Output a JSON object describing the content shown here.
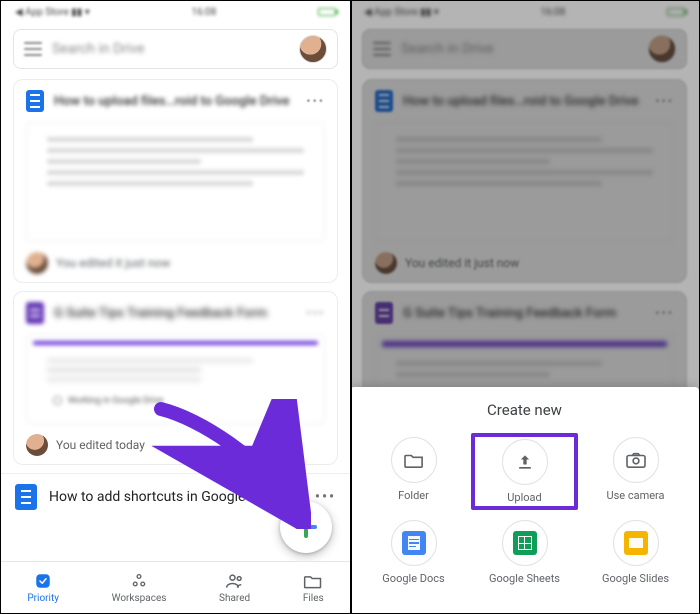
{
  "left": {
    "search_placeholder": "Search in Drive",
    "card1": {
      "title": "How to upload files…roid to Google Drive",
      "footer": "You edited it just now"
    },
    "card2": {
      "title": "G Suite Tips Training Feedback Form",
      "working": "Working in Google Drive",
      "footer": "You edited today"
    },
    "row_title": "How to add shortcuts in Google Drive",
    "nav": {
      "priority": "Priority",
      "workspaces": "Workspaces",
      "shared": "Shared",
      "files": "Files"
    }
  },
  "right": {
    "sheet_title": "Create new",
    "items": {
      "folder": "Folder",
      "upload": "Upload",
      "camera": "Use camera",
      "docs": "Google Docs",
      "sheets": "Google Sheets",
      "slides": "Google Slides"
    }
  }
}
